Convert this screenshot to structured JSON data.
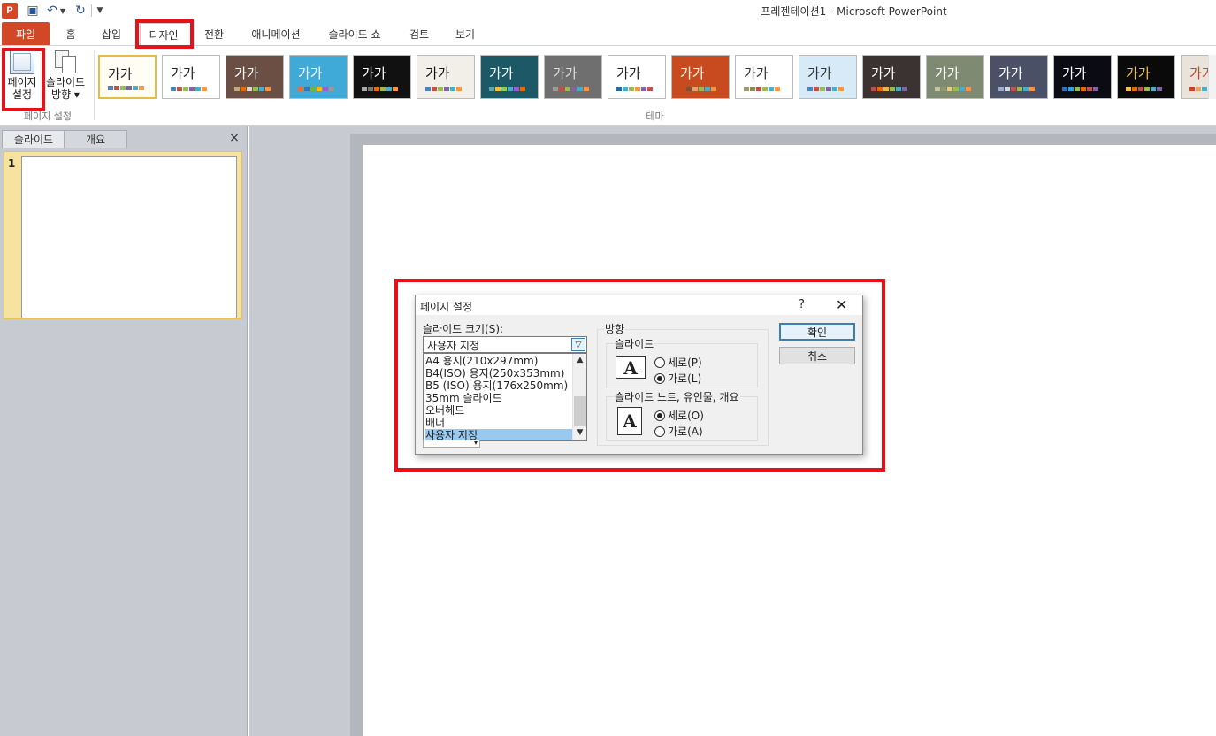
{
  "window": {
    "title": "프레젠테이션1 - Microsoft PowerPoint",
    "logo_letter": "P"
  },
  "quick_access": {
    "save_icon": "save-icon",
    "undo_icon": "undo-icon",
    "redo_icon": "redo-icon"
  },
  "tabs": [
    "파일",
    "홈",
    "삽입",
    "디자인",
    "전환",
    "애니메이션",
    "슬라이드 쇼",
    "검토",
    "보기"
  ],
  "ribbon": {
    "page_setup": {
      "line1": "페이지",
      "line2": "설정"
    },
    "orientation": {
      "line1": "슬라이드",
      "line2": "방향 ▾"
    },
    "group_page_setup_label": "페이지 설정",
    "group_themes_label": "테마",
    "themes": [
      {
        "text": "가가",
        "bg": "#ffffff",
        "fg": "#222222",
        "dots": [
          "#4f81bd",
          "#c0504d",
          "#9bbb59",
          "#8064a2",
          "#4bacc6",
          "#f79646"
        ]
      },
      {
        "text": "가가",
        "bg": "#ffffff",
        "fg": "#222222",
        "dots": [
          "#4f81bd",
          "#c0504d",
          "#9bbb59",
          "#8064a2",
          "#4bacc6",
          "#f79646"
        ]
      },
      {
        "text": "가가",
        "bg": "#6b4f45",
        "fg": "#ffffff",
        "dots": [
          "#c9a97a",
          "#e36c09",
          "#ddd9c3",
          "#9bbb59",
          "#4bacc6",
          "#f79646"
        ]
      },
      {
        "text": "가가",
        "bg": "#3fa9d8",
        "fg": "#ffffff",
        "dots": [
          "#f26d21",
          "#2c7bb6",
          "#76b041",
          "#ffc000",
          "#a05ad6",
          "#999999"
        ]
      },
      {
        "text": "가가",
        "bg": "#111111",
        "fg": "#ffffff",
        "dots": [
          "#aaaaaa",
          "#777777",
          "#e36c09",
          "#9bbb59",
          "#4bacc6",
          "#f79646"
        ]
      },
      {
        "text": "가가",
        "bg": "#f2efe8",
        "fg": "#111111",
        "dots": [
          "#4f81bd",
          "#c0504d",
          "#9bbb59",
          "#8064a2",
          "#4bacc6",
          "#f79646"
        ]
      },
      {
        "text": "가가",
        "bg": "#1d5866",
        "fg": "#ffffff",
        "dots": [
          "#5aa6b8",
          "#f0c03f",
          "#8fd14f",
          "#4bacc6",
          "#a05ad6",
          "#e36c09"
        ]
      },
      {
        "text": "가가",
        "bg": "#6f6f6f",
        "fg": "#dddddd",
        "dots": [
          "#999999",
          "#c0504d",
          "#9bbb59",
          "#8064a2",
          "#4bacc6",
          "#f79646"
        ]
      },
      {
        "text": "가가",
        "bg": "#ffffff",
        "fg": "#222222",
        "dots": [
          "#1f6ca8",
          "#4bacc6",
          "#9bbb59",
          "#f79646",
          "#8064a2",
          "#c0504d"
        ]
      },
      {
        "text": "가가",
        "bg": "#c84b1f",
        "fg": "#ffffff",
        "dots": [
          "#c84b1f",
          "#7f4f3a",
          "#e0a36b",
          "#9bbb59",
          "#4bacc6",
          "#f79646"
        ]
      },
      {
        "text": "가가",
        "bg": "#ffffff",
        "fg": "#333333",
        "dots": [
          "#a39775",
          "#8a8d54",
          "#c0504d",
          "#9bbb59",
          "#4bacc6",
          "#f79646"
        ]
      },
      {
        "text": "가가",
        "bg": "#d6eaf8",
        "fg": "#333333",
        "dots": [
          "#4f81bd",
          "#c0504d",
          "#9bbb59",
          "#8064a2",
          "#4bacc6",
          "#f79646"
        ]
      },
      {
        "text": "가가",
        "bg": "#3a3331",
        "fg": "#ffffff",
        "dots": [
          "#c0504d",
          "#e36c09",
          "#f2b53e",
          "#9bbb59",
          "#4bacc6",
          "#8064a2"
        ]
      },
      {
        "text": "가가",
        "bg": "#7f8a72",
        "fg": "#ffffff",
        "dots": [
          "#c9c5a0",
          "#8c9a74",
          "#e0d080",
          "#9bbb59",
          "#4bacc6",
          "#f79646"
        ]
      },
      {
        "text": "가가",
        "bg": "#4a5066",
        "fg": "#ffffff",
        "dots": [
          "#9fa8d0",
          "#d0d6e6",
          "#c0504d",
          "#9bbb59",
          "#4bacc6",
          "#f79646"
        ]
      },
      {
        "text": "가가",
        "bg": "#0b0b14",
        "fg": "#ffffff",
        "dots": [
          "#2f6fb5",
          "#3aa0d8",
          "#9bbb59",
          "#e36c09",
          "#c0504d",
          "#8064a2"
        ]
      },
      {
        "text": "가가",
        "bg": "#0a0a0a",
        "fg": "#f0c03f",
        "dots": [
          "#f0c03f",
          "#e36c09",
          "#c0504d",
          "#9bbb59",
          "#4bacc6",
          "#8064a2"
        ]
      },
      {
        "text": "가가",
        "bg": "#e9e3da",
        "fg": "#c8452e",
        "dots": [
          "#c8452e",
          "#e0a36b",
          "#4bacc6",
          "#9bbb59",
          "#8064a2",
          "#f79646"
        ]
      }
    ]
  },
  "pane": {
    "tab_slides": "슬라이드",
    "tab_outline": "개요",
    "close_glyph": "×",
    "slide_number": "1"
  },
  "dialog": {
    "title": "페이지 설정",
    "help_glyph": "?",
    "close_glyph": "✕",
    "slide_size_label": "슬라이드 크기(S):",
    "slide_size_value": "사용자 지정",
    "size_options": [
      "A4 용지(210x297mm)",
      "B4(ISO) 용지(250x353mm)",
      "B5 (ISO) 용지(176x250mm)",
      "35mm 슬라이드",
      "오버헤드",
      "배너",
      "사용자 지정"
    ],
    "selected_option_index": 6,
    "orientation_label": "방향",
    "slides_label": "슬라이드",
    "slides_portrait": "세로(P)",
    "slides_landscape": "가로(L)",
    "slides_selected": "landscape",
    "notes_label": "슬라이드 노트, 유인물, 개요",
    "notes_portrait": "세로(O)",
    "notes_landscape": "가로(A)",
    "notes_selected": "portrait",
    "orientation_icon_letter": "A",
    "ok_label": "확인",
    "cancel_label": "취소"
  },
  "colors": {
    "file_tab": "#d24726",
    "highlight": "#e8111a",
    "list_selection": "#99c9ef"
  }
}
